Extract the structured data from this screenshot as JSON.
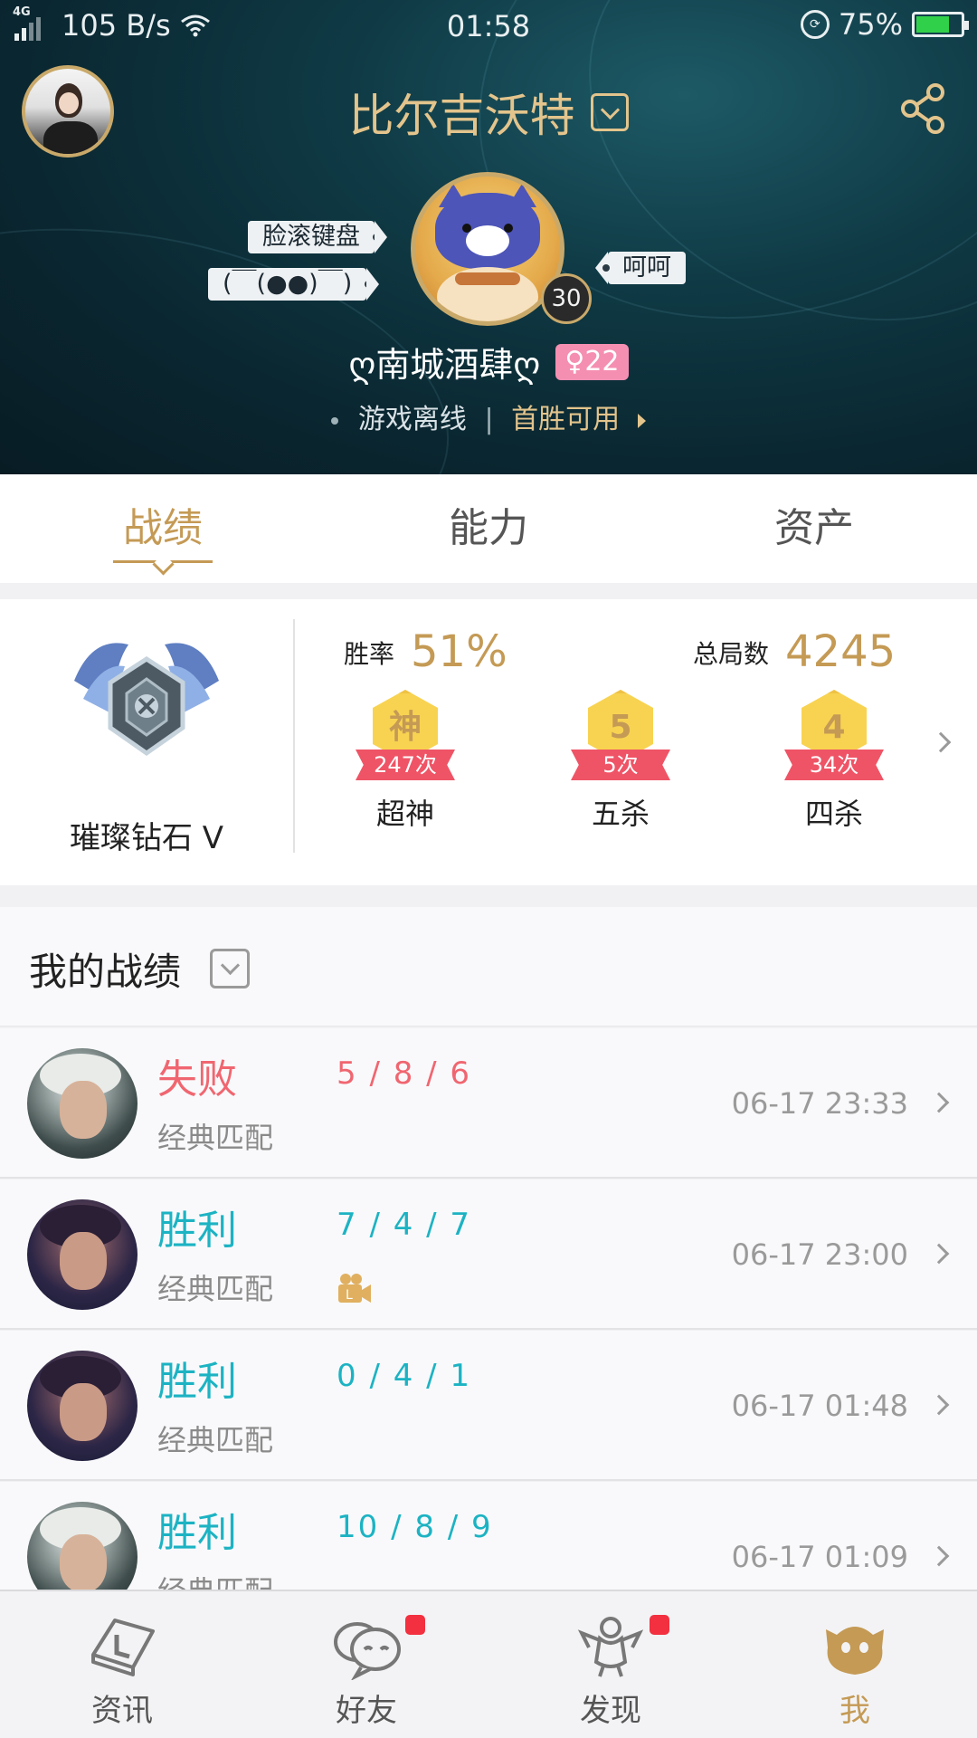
{
  "status_bar": {
    "network": "4G",
    "speed": "105 B/s",
    "time": "01:58",
    "battery": "75%",
    "battery_level": 0.75
  },
  "header": {
    "title": "比尔吉沃特",
    "tags": [
      "脸滚键盘",
      "(￣(●●)￣)",
      "呵呵"
    ],
    "level": "30",
    "nickname": "ღ南城酒肆ღ",
    "gender_level": "♀22",
    "status": "游戏离线",
    "separator": "|",
    "first_win": "首胜可用"
  },
  "tabs": [
    "战绩",
    "能力",
    "资产"
  ],
  "stats": {
    "rank": "璀璨钻石 V",
    "win_rate_label": "胜率",
    "win_rate": "51%",
    "total_games_label": "总局数",
    "total_games": "4245",
    "medals": [
      {
        "glyph": "神",
        "count": "247次",
        "name": "超神"
      },
      {
        "glyph": "5",
        "count": "5次",
        "name": "五杀"
      },
      {
        "glyph": "4",
        "count": "34次",
        "name": "四杀"
      }
    ]
  },
  "records": {
    "title": "我的战绩",
    "matches": [
      {
        "result": "失败",
        "kda": "5 / 8 / 6",
        "mode": "经典匹配",
        "time": "06-17 23:33"
      },
      {
        "result": "胜利",
        "kda": "7 / 4 / 7",
        "mode": "经典匹配",
        "time": "06-17 23:00"
      },
      {
        "result": "胜利",
        "kda": "0 / 4 / 1",
        "mode": "经典匹配",
        "time": "06-17 01:48"
      },
      {
        "result": "胜利",
        "kda": "10 / 8 / 9",
        "mode": "经典匹配",
        "time": "06-17 01:09"
      }
    ]
  },
  "bottom_nav": [
    {
      "label": "资讯",
      "icon": "news-icon"
    },
    {
      "label": "好友",
      "icon": "friends-icon"
    },
    {
      "label": "发现",
      "icon": "discover-icon"
    },
    {
      "label": "我",
      "icon": "me-icon"
    }
  ],
  "colors": {
    "gold": "#c49a55",
    "win": "#1cb3c3",
    "loss": "#f06670",
    "badge_red": "#f2303f",
    "medal_ribbon": "#ef5466"
  }
}
